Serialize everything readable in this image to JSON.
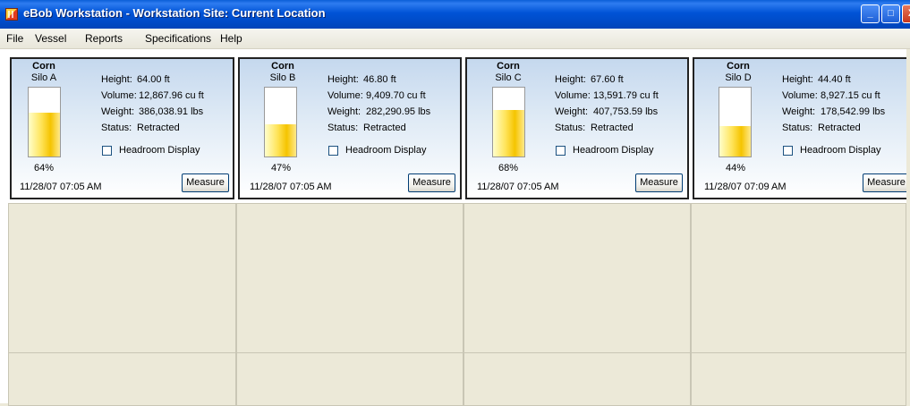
{
  "window": {
    "title": "eBob Workstation - Workstation Site: Current Location",
    "controls": {
      "minimize": "_",
      "maximize": "□",
      "close": "X"
    }
  },
  "menu": [
    {
      "label": "File"
    },
    {
      "label": "Vessel"
    },
    {
      "label": "Reports"
    },
    {
      "label": "Specifications"
    },
    {
      "label": "Help"
    }
  ],
  "silos": [
    {
      "commodity": "Corn",
      "name": "Silo A",
      "percent_label": "64%",
      "level": 0.64,
      "height_label": "Height:",
      "height": "64.00 ft",
      "volume_label": "Volume:",
      "volume": "12,867.96 cu ft",
      "weight_label": "Weight:",
      "weight": "386,038.91 lbs",
      "status_label": "Status:",
      "status": "Retracted",
      "headroom_label": "Headroom Display",
      "headroom_checked": false,
      "timestamp": "11/28/07 07:05 AM",
      "measure_label": "Measure"
    },
    {
      "commodity": "Corn",
      "name": "Silo B",
      "percent_label": "47%",
      "level": 0.47,
      "height_label": "Height:",
      "height": "46.80 ft",
      "volume_label": "Volume:",
      "volume": "9,409.70 cu ft",
      "weight_label": "Weight:",
      "weight": "282,290.95 lbs",
      "status_label": "Status:",
      "status": "Retracted",
      "headroom_label": "Headroom Display",
      "headroom_checked": false,
      "timestamp": "11/28/07 07:05 AM",
      "measure_label": "Measure"
    },
    {
      "commodity": "Corn",
      "name": "Silo C",
      "percent_label": "68%",
      "level": 0.68,
      "height_label": "Height:",
      "height": "67.60 ft",
      "volume_label": "Volume:",
      "volume": "13,591.79 cu ft",
      "weight_label": "Weight:",
      "weight": "407,753.59 lbs",
      "status_label": "Status:",
      "status": "Retracted",
      "headroom_label": "Headroom Display",
      "headroom_checked": false,
      "timestamp": "11/28/07 07:05 AM",
      "measure_label": "Measure"
    },
    {
      "commodity": "Corn",
      "name": "Silo D",
      "percent_label": "44%",
      "level": 0.44,
      "height_label": "Height:",
      "height": "44.40 ft",
      "volume_label": "Volume:",
      "volume": "8,927.15 cu ft",
      "weight_label": "Weight:",
      "weight": "178,542.99 lbs",
      "status_label": "Status:",
      "status": "Retracted",
      "headroom_label": "Headroom Display",
      "headroom_checked": false,
      "timestamp": "11/28/07 07:09 AM",
      "measure_label": "Measure"
    }
  ],
  "colors": {
    "titlebar": "#0053d6",
    "panel_gradient_top": "#c5d8ee",
    "gauge_fill": "#f5c400",
    "empty_cell": "#ece9d8"
  }
}
